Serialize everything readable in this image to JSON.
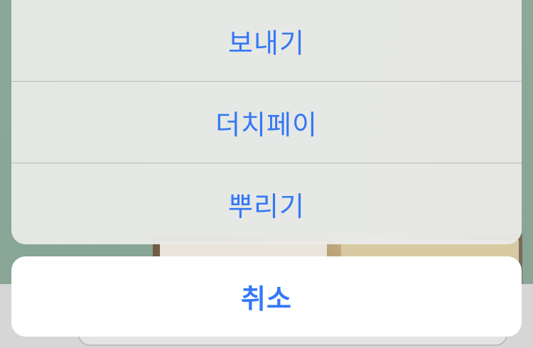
{
  "sheet": {
    "actions": [
      {
        "label": "보내기"
      },
      {
        "label": "더치페이"
      },
      {
        "label": "뿌리기"
      }
    ],
    "cancel_label": "취소"
  },
  "colors": {
    "accent": "#3478f6",
    "sheet_background": "#ececea",
    "cancel_background": "#ffffff",
    "divider": "#b9b9b9"
  }
}
